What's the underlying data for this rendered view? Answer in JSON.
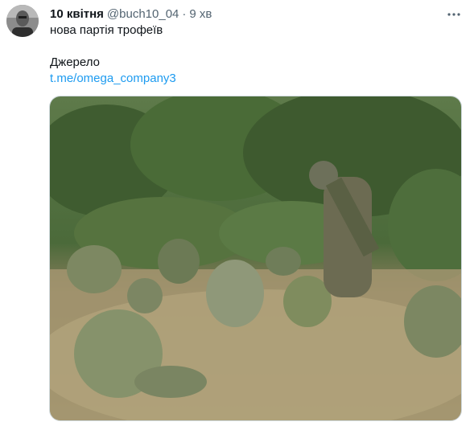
{
  "tweet": {
    "author_name": "10 квітня",
    "handle": "@buch10_04",
    "separator": "·",
    "time": "9 хв",
    "text_line1": "нова партія трофеїв",
    "text_line2": "Джерело",
    "link_text": "t.me/omega_company3",
    "more_icon": "more-dots-icon"
  },
  "colors": {
    "text": "#0f1419",
    "secondary": "#536471",
    "link": "#1d9bf0",
    "border": "#cfd9de"
  }
}
